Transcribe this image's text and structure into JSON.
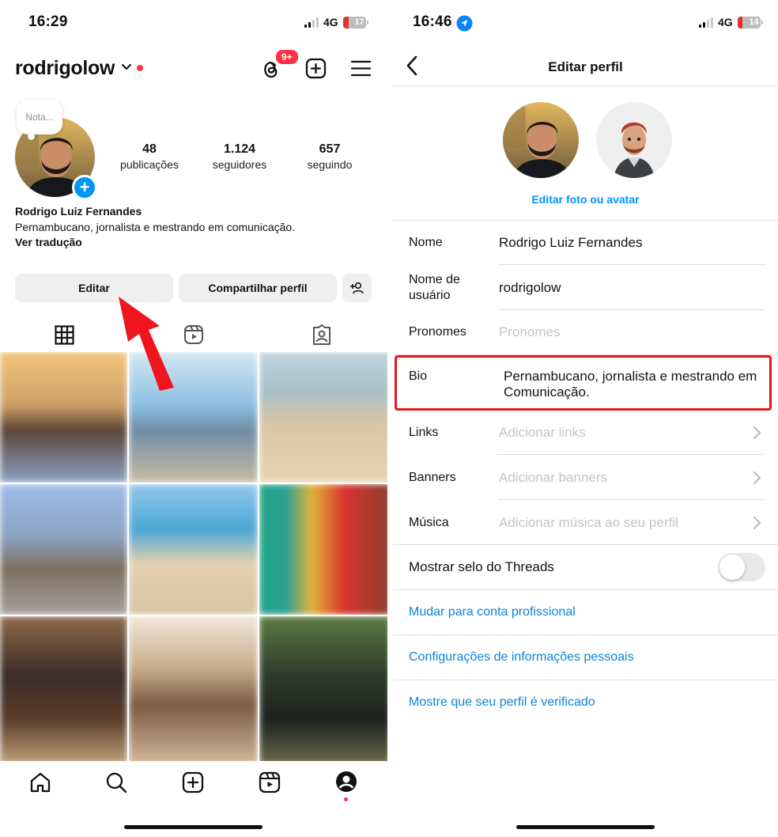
{
  "left": {
    "status": {
      "time": "16:29",
      "network": "4G",
      "battery": "17"
    },
    "header": {
      "username": "rodrigolow",
      "threads_badge": "9+"
    },
    "note_placeholder": "Nota...",
    "stats": [
      {
        "value": "48",
        "label": "publicações"
      },
      {
        "value": "1.124",
        "label": "seguidores"
      },
      {
        "value": "657",
        "label": "seguindo"
      }
    ],
    "full_name": "Rodrigo Luiz Fernandes",
    "bio": "Pernambucano, jornalista e mestrando em comunicação.",
    "translate_link": "Ver tradução",
    "buttons": {
      "edit": "Editar",
      "share": "Compartilhar perfil"
    },
    "tabs": [
      "grid-icon",
      "reels-icon",
      "tagged-icon"
    ],
    "bottom_nav": [
      "home-icon",
      "search-icon",
      "create-icon",
      "reels-icon",
      "profile-icon"
    ],
    "colors": {
      "accent": "#0095f6",
      "notification": "#ff3040",
      "arrow": "#f0141e"
    }
  },
  "right": {
    "status": {
      "time": "16:46",
      "network": "4G",
      "battery": "14"
    },
    "title": "Editar perfil",
    "edit_photo": "Editar foto ou avatar",
    "fields": {
      "name": {
        "label": "Nome",
        "value": "Rodrigo Luiz Fernandes"
      },
      "username": {
        "label": "Nome de\nusuário",
        "value": "rodrigolow"
      },
      "pronouns": {
        "label": "Pronomes",
        "placeholder": "Pronomes"
      },
      "bio": {
        "label": "Bio",
        "value": "Pernambucano, jornalista e mestrando em Comunicação."
      },
      "links": {
        "label": "Links",
        "placeholder": "Adicionar links"
      },
      "banners": {
        "label": "Banners",
        "placeholder": "Adicionar banners"
      },
      "music": {
        "label": "Música",
        "placeholder": "Adicionar música ao seu perfil"
      }
    },
    "threads_badge": {
      "label": "Mostrar selo do Threads",
      "enabled": false
    },
    "links": {
      "professional": "Mudar para conta profissional",
      "personal_info": "Configurações de informações pessoais",
      "verified": "Mostre que seu perfil é verificado"
    },
    "colors": {
      "link": "#0a84d6",
      "highlight_box": "#e8141c"
    }
  }
}
